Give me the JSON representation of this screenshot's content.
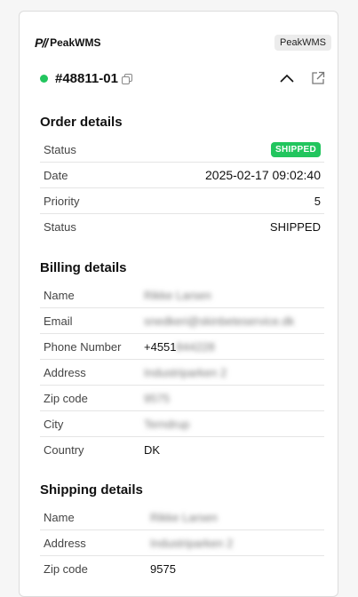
{
  "header": {
    "logo_text": "PeakWMS",
    "badge": "PeakWMS"
  },
  "order": {
    "id": "#48811-01"
  },
  "order_details": {
    "title": "Order details",
    "rows": [
      {
        "label": "Status",
        "value": "SHIPPED"
      },
      {
        "label": "Date",
        "value": "2025-02-17 09:02:40"
      },
      {
        "label": "Priority",
        "value": "5"
      },
      {
        "label": "Status",
        "value": "SHIPPED"
      }
    ]
  },
  "billing_details": {
    "title": "Billing details",
    "rows": [
      {
        "label": "Name",
        "value": "Rikke Larsen"
      },
      {
        "label": "Email",
        "value": "snedkeri@skinbeteservice.dk"
      },
      {
        "label": "Phone Number",
        "value": "+4551",
        "hidden": "844228"
      },
      {
        "label": "Address",
        "value": "Industriparken 2"
      },
      {
        "label": "Zip code",
        "value": "9575"
      },
      {
        "label": "City",
        "value": "Terndrup"
      },
      {
        "label": "Country",
        "value": "DK"
      }
    ]
  },
  "shipping_details": {
    "title": "Shipping details",
    "rows": [
      {
        "label": "Name",
        "value": "Rikke Larsen"
      },
      {
        "label": "Address",
        "value": "Industriparken 2"
      },
      {
        "label": "Zip code",
        "value": "9575"
      }
    ]
  },
  "colors": {
    "status_green": "#22c55e",
    "border": "#e5e5e5"
  }
}
